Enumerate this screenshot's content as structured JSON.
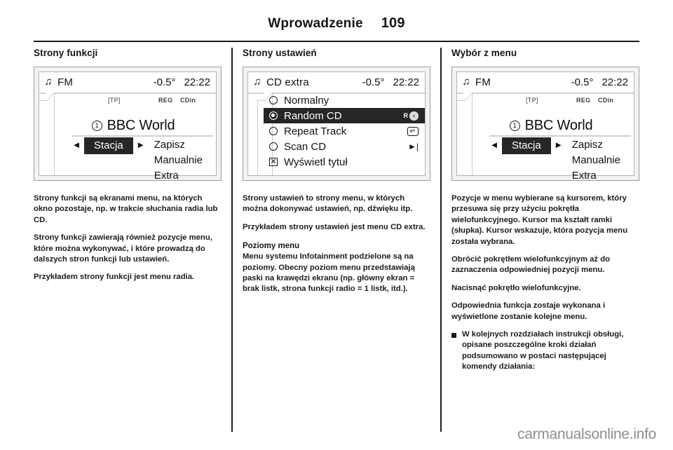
{
  "header": {
    "title": "Wprowadzenie",
    "page_number": "109"
  },
  "columns": {
    "left": {
      "heading": "Strony funkcji",
      "paragraphs": [
        "Strony funkcji są ekranami menu, na których okno pozostaje, np. w trakcie słuchania radia lub CD.",
        "Strony funkcji zawierają również pozycje menu, które można wykonywać, i które prowadzą do dalszych stron funkcji lub ustawień.",
        "Przykładem strony funkcji jest menu radia."
      ]
    },
    "middle": {
      "heading": "Strony ustawień",
      "paragraphs": [
        "Strony ustawień to strony menu, w których można dokonywać ustawień, np. dźwięku itp.",
        "Przykładem strony ustawień jest menu CD extra."
      ],
      "subheading": "Poziomy menu",
      "paragraphs2": [
        "Menu systemu Infotainment podzielone są na poziomy. Obecny poziom menu przedstawiają paski na krawędzi ekranu (np. główny ekran = brak listk, strona funkcji radio = 1 listk, itd.)."
      ]
    },
    "right": {
      "heading": "Wybór z menu",
      "paragraphs": [
        "Pozycje w menu wybierane są kursorem, który przesuwa się przy użyciu pokrętła wielofunkcyjnego. Kursor ma kształt ramki (słupka). Kursor wskazuje, która pozycja menu została wybrana.",
        "Obrócić pokrętłem wielofunkcyjnym aż do zaznaczenia odpowiedniej pozycji menu.",
        "Nacisnąć pokrętło wielofunkcyjne.",
        "Odpowiednia funkcja zostaje wykonana i wyświetlone zostanie kolejne menu."
      ],
      "bullets": [
        "W kolejnych rozdziałach instrukcji obsługi, opisane poszczególne kroki działań podsumowano w postaci następującej komendy działania:"
      ]
    }
  },
  "radio_display": {
    "note_icon": "♫",
    "source": "FM",
    "temperature": "-0.5°",
    "time": "22:22",
    "rds_tp": "[TP]",
    "rds_reg": "REG",
    "rds_cdin": "CDin",
    "preset_number": "1",
    "station_name": "BBC World",
    "soft_left_arrow": "◄",
    "soft_right_arrow": "►",
    "selected_chip": "Stacja",
    "menu_items": [
      "Zapisz",
      "Manualnie",
      "Extra"
    ]
  },
  "cd_display": {
    "note_icon": "♫",
    "source": "CD extra",
    "temperature": "-0.5°",
    "time": "22:22",
    "rows": [
      {
        "label": "Normalny",
        "control": "radio",
        "selected": false,
        "glyph": ""
      },
      {
        "label": "Random CD",
        "control": "radio",
        "selected": true,
        "glyph": "random"
      },
      {
        "label": "Repeat Track",
        "control": "radio",
        "selected": false,
        "glyph": "repeat"
      },
      {
        "label": "Scan CD",
        "control": "radio",
        "selected": false,
        "glyph": "scan"
      },
      {
        "label": "Wyświetl tytuł",
        "control": "checkbox",
        "selected": true,
        "glyph": ""
      }
    ],
    "random_badge_letter": "R",
    "scan_glyph": "►|",
    "repeat_glyph": "↵",
    "checkbox_mark": "✕"
  },
  "watermark": "carmanualsonline.info"
}
